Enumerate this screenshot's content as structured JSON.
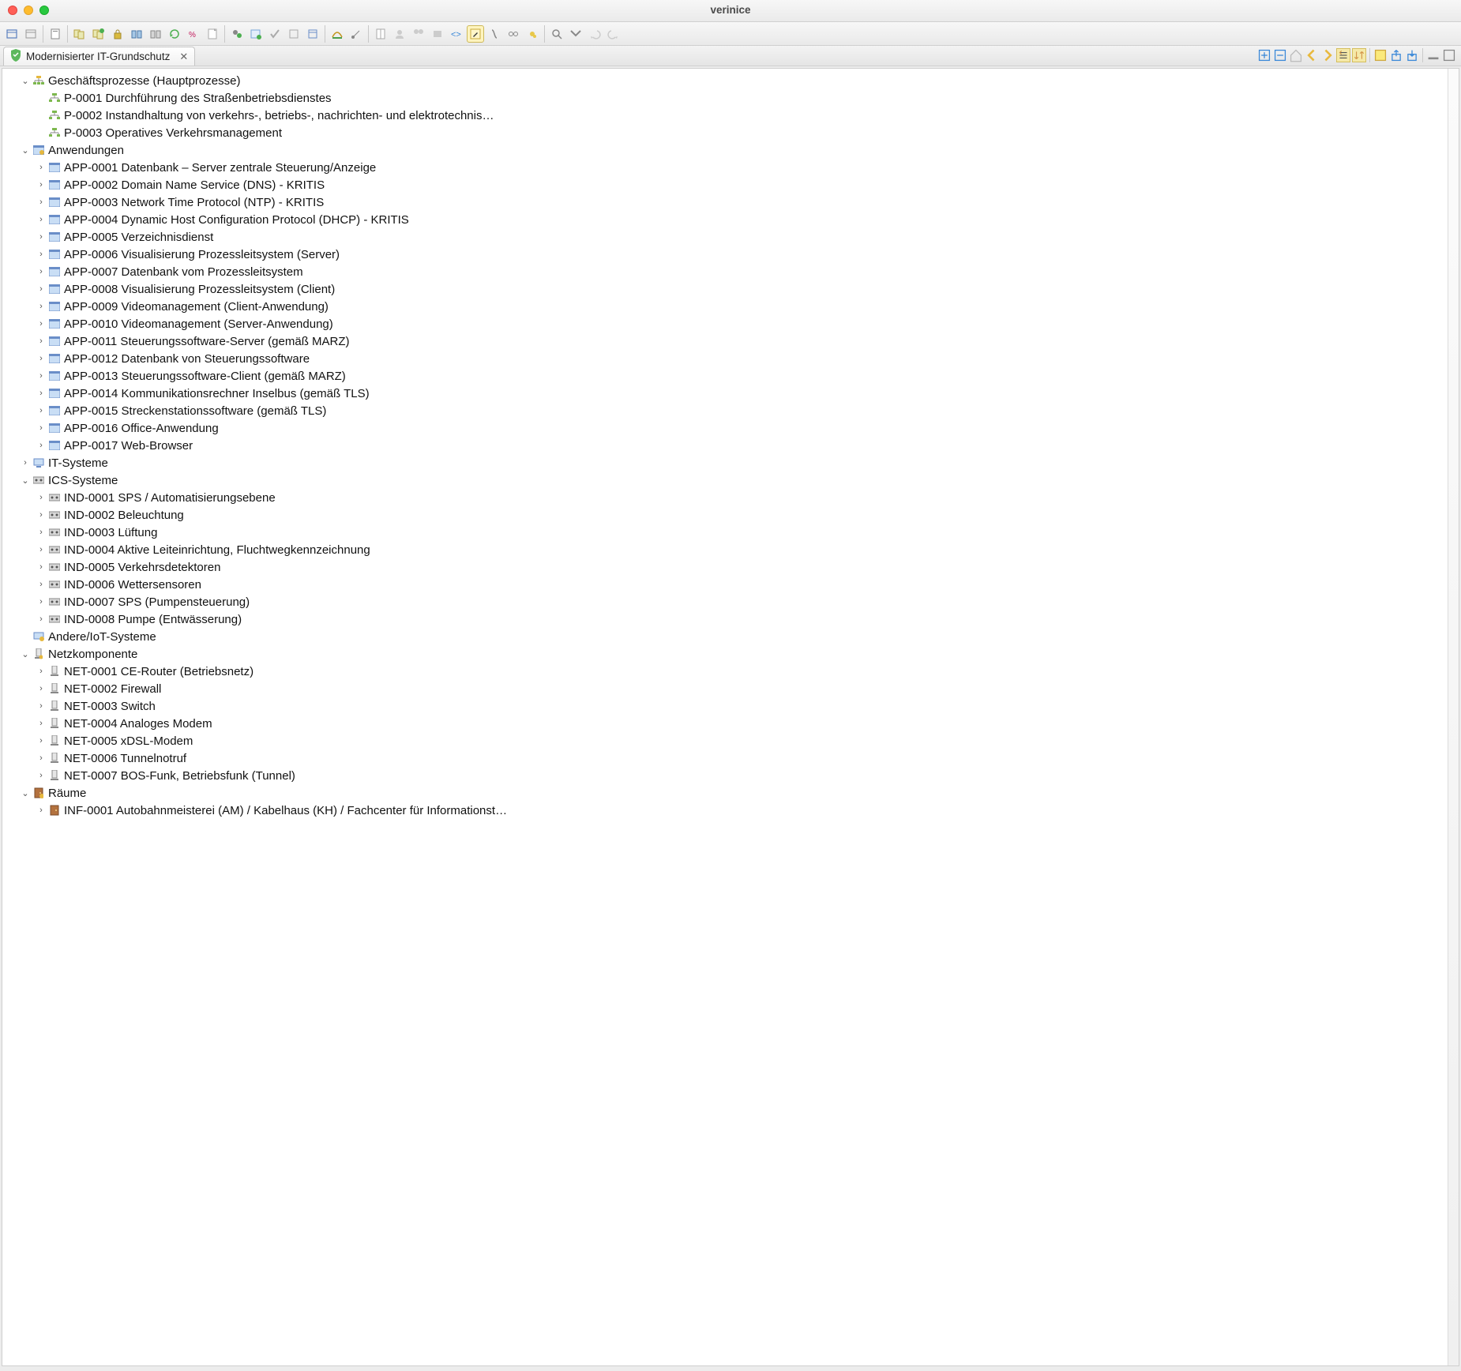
{
  "window_title": "verinice",
  "tab_label": "Modernisierter IT-Grundschutz",
  "tree": {
    "root_partial": "…",
    "geschaeftsprozesse": {
      "label": "Geschäftsprozesse (Hauptprozesse)",
      "items": [
        "P-0001 Durchführung des Straßenbetriebsdienstes",
        "P-0002 Instandhaltung von verkehrs-, betriebs-, nachrichten- und elektrotechnis…",
        "P-0003 Operatives Verkehrsmanagement"
      ]
    },
    "anwendungen": {
      "label": "Anwendungen",
      "items": [
        "APP-0001 Datenbank – Server zentrale Steuerung/Anzeige",
        "APP-0002 Domain Name Service (DNS) - KRITIS",
        "APP-0003 Network Time Protocol (NTP) - KRITIS",
        "APP-0004 Dynamic Host Configuration Protocol (DHCP) - KRITIS",
        "APP-0005 Verzeichnisdienst",
        "APP-0006 Visualisierung Prozessleitsystem (Server)",
        "APP-0007 Datenbank vom Prozessleitsystem",
        "APP-0008 Visualisierung Prozessleitsystem (Client)",
        "APP-0009 Videomanagement (Client-Anwendung)",
        "APP-0010 Videomanagement (Server-Anwendung)",
        "APP-0011 Steuerungssoftware-Server (gemäß MARZ)",
        "APP-0012 Datenbank von Steuerungssoftware",
        "APP-0013 Steuerungssoftware-Client (gemäß MARZ)",
        "APP-0014 Kommunikationsrechner Inselbus (gemäß TLS)",
        "APP-0015 Streckenstationssoftware (gemäß TLS)",
        "APP-0016 Office-Anwendung",
        "APP-0017 Web-Browser"
      ]
    },
    "itsysteme": {
      "label": "IT-Systeme"
    },
    "icssysteme": {
      "label": "ICS-Systeme",
      "items": [
        "IND-0001 SPS / Automatisierungsebene",
        "IND-0002 Beleuchtung",
        "IND-0003 Lüftung",
        "IND-0004 Aktive Leiteinrichtung, Fluchtwegkennzeichnung",
        "IND-0005 Verkehrsdetektoren",
        "IND-0006 Wettersensoren",
        "IND-0007 SPS (Pumpensteuerung)",
        "IND-0008 Pumpe (Entwässerung)"
      ]
    },
    "andere_iot": {
      "label": "Andere/IoT-Systeme"
    },
    "netz": {
      "label": "Netzkomponente",
      "items": [
        "NET-0001 CE-Router (Betriebsnetz)",
        "NET-0002 Firewall",
        "NET-0003 Switch",
        "NET-0004 Analoges Modem",
        "NET-0005 xDSL-Modem",
        "NET-0006 Tunnelnotruf",
        "NET-0007 BOS-Funk, Betriebsfunk (Tunnel)"
      ]
    },
    "raeume": {
      "label": "Räume",
      "items": [
        "INF-0001 Autobahnmeisterei (AM) / Kabelhaus (KH) / Fachcenter für Informationst…"
      ]
    }
  }
}
